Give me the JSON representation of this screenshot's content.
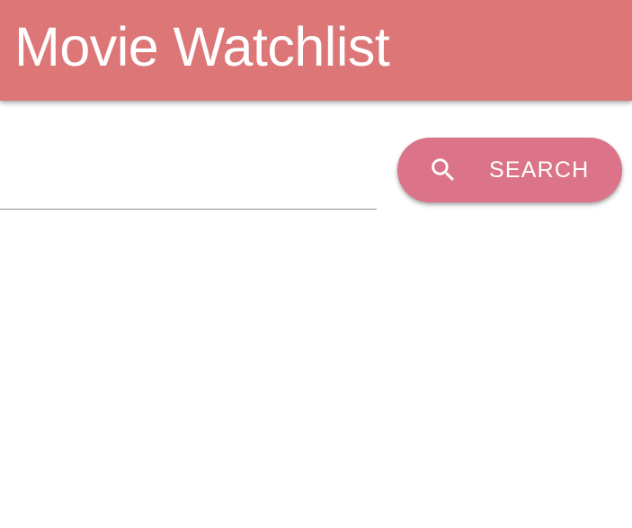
{
  "app_bar": {
    "title": "Movie Watchlist",
    "background_color": "#dd7777"
  },
  "search": {
    "input_value": "",
    "input_placeholder": "",
    "button_label": "SEARCH",
    "button_icon": "search-icon",
    "button_color": "#db7488"
  }
}
